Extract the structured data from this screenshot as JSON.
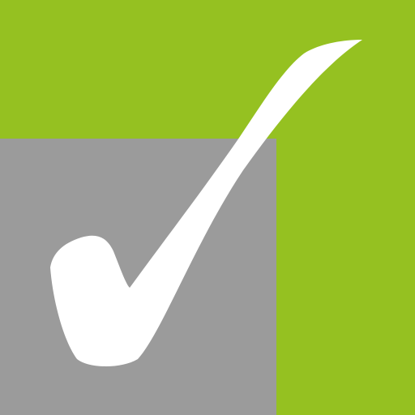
{
  "icon": {
    "name": "checkmark-app-icon",
    "symbol": "checkmark-icon",
    "colors": {
      "background": "#95c121",
      "square": "#9b9b9b",
      "check": "#ffffff"
    }
  }
}
